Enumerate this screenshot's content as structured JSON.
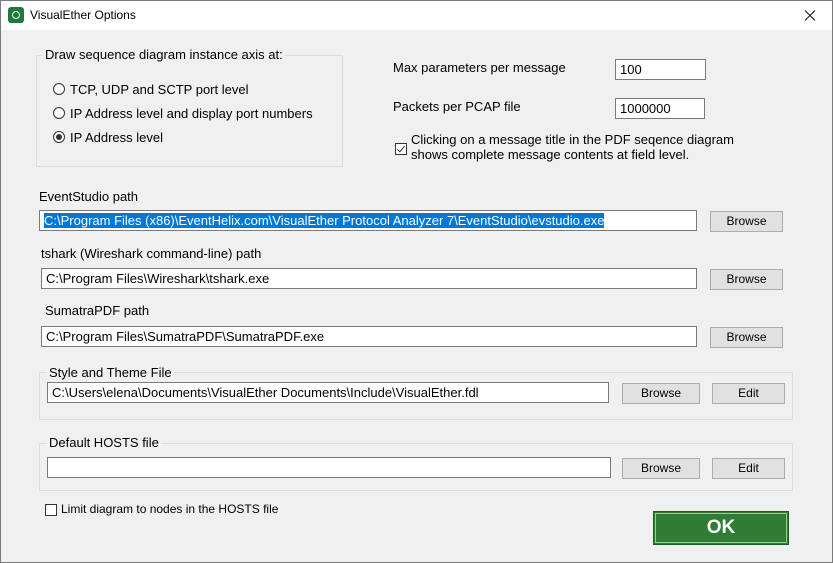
{
  "window": {
    "title": "VisualEther Options"
  },
  "axis_group": {
    "legend": "Draw sequence diagram instance axis at:",
    "options": [
      {
        "label": "TCP, UDP and SCTP port level",
        "selected": false
      },
      {
        "label": "IP Address level and display port numbers",
        "selected": false
      },
      {
        "label": "IP Address level",
        "selected": true
      }
    ]
  },
  "max_params": {
    "label": "Max parameters per message",
    "value": "100"
  },
  "packets_pcap": {
    "label": "Packets per PCAP file",
    "value": "1000000"
  },
  "pdf_click": {
    "label_line1": "Clicking on a message title in the PDF seqence diagram",
    "label_line2": "shows complete message contents at field level.",
    "checked": true
  },
  "eventstudio": {
    "label": "EventStudio path",
    "value": "C:\\Program Files (x86)\\EventHelix.com\\VisualEther Protocol Analyzer 7\\EventStudio\\evstudio.exe",
    "browse": "Browse"
  },
  "tshark": {
    "label": "tshark (Wireshark command-line) path",
    "value": "C:\\Program Files\\Wireshark\\tshark.exe",
    "browse": "Browse"
  },
  "sumatra": {
    "label": "SumatraPDF path",
    "value": "C:\\Program Files\\SumatraPDF\\SumatraPDF.exe",
    "browse": "Browse"
  },
  "style_theme": {
    "legend": "Style and Theme File",
    "value": "C:\\Users\\elena\\Documents\\VisualEther Documents\\Include\\VisualEther.fdl",
    "browse": "Browse",
    "edit": "Edit"
  },
  "hosts": {
    "legend": "Default HOSTS file",
    "value": "",
    "browse": "Browse",
    "edit": "Edit"
  },
  "limit_hosts": {
    "label": "Limit diagram to nodes in the HOSTS file",
    "checked": false
  },
  "ok": {
    "label": "OK"
  }
}
